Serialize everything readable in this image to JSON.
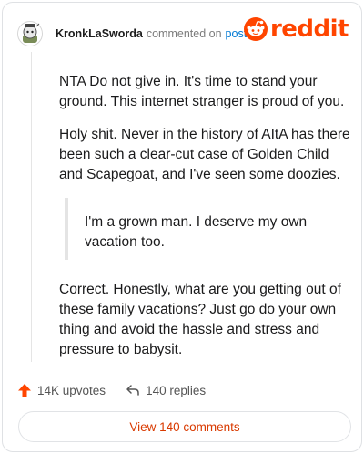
{
  "header": {
    "username": "KronkLaSworda",
    "action_text": "commented on",
    "post_link": "post",
    "brand": "reddit",
    "brand_color": "#ff4500",
    "avatar_icon": "snoo-avatar-icon"
  },
  "comment": {
    "para1": "NTA Do not give in. It's time to stand your ground. This internet stranger is proud of you.",
    "para2": "Holy shit. Never in the history of AItA has there been such a clear-cut case of Golden Child and Scapegoat, and I've seen some doozies.",
    "quote": "I'm a grown man. I deserve my own vacation too.",
    "para3": "Correct. Honestly, what are you getting out of these family vacations? Just go do your own thing and avoid the hassle and stress and pressure to babysit."
  },
  "stats": {
    "upvotes": "14K upvotes",
    "replies": "140 replies",
    "upvote_icon": "upvote-arrow-icon",
    "reply_icon": "reply-arrow-icon"
  },
  "footer": {
    "view_comments": "View 140 comments",
    "accent": "#d93a00"
  }
}
